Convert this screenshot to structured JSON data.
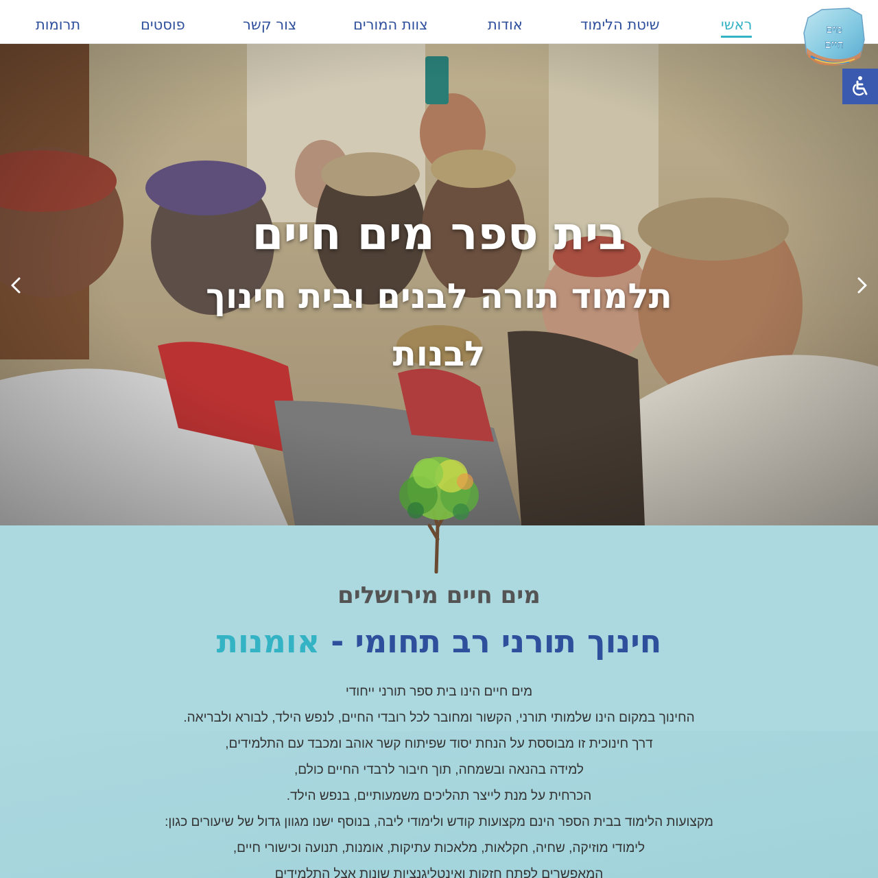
{
  "nav": {
    "items": [
      {
        "label": "ראשי",
        "active": true
      },
      {
        "label": "שיטת הלימוד"
      },
      {
        "label": "אודות"
      },
      {
        "label": "צוות המורים"
      },
      {
        "label": "צור קשר"
      },
      {
        "label": "פוסטים"
      },
      {
        "label": "תרומות"
      }
    ]
  },
  "logo": {
    "text": "מים חיים"
  },
  "hero": {
    "title": "בית ספר מים חיים",
    "subtitle": "תלמוד תורה לבנים ובית חינוך לבנות"
  },
  "section": {
    "subtitle": "מים חיים מירושלים",
    "title_main": "חינוך תורני רב תחומי - ",
    "title_accent": "אומנות",
    "paragraphs": [
      "מים חיים הינו בית ספר תורני ייחודי",
      "החינוך במקום הינו שלמותי תורני, הקשור ומחובר לכל רובדי החיים, לנפש הילד, לבורא ולבריאה.",
      "דרך חינוכית זו מבוססת על הנחת יסוד שפיתוח קשר אוהב ומכבד עם התלמידים,",
      "למידה  בהנאה ובשמחה, תוך חיבור לרבדי החיים כולם,",
      "הכרחית על מנת לייצר תהליכים משמעותיים, בנפש הילד.",
      "מקצועות הלימוד בבית הספר הינם מקצועות קודש ולימודי ליבה, בנוסף ישנו מגוון גדול של שיעורים כגון:",
      "לימודי מוזיקה, שחיה, חקלאות, מלאכות עתיקות, אומנות, תנועה וכישורי חיים,",
      "המאפשרים לפתח חזקות ואינטליגנציות שונות אצל התלמידים"
    ]
  },
  "colors": {
    "nav": "#2e4f9c",
    "accent": "#33b3c4",
    "content_bg": "#acd8df",
    "a11y": "#3a5ab0"
  },
  "icons": [
    "accessibility-icon",
    "chevron-left-icon",
    "chevron-right-icon",
    "tree-icon"
  ]
}
